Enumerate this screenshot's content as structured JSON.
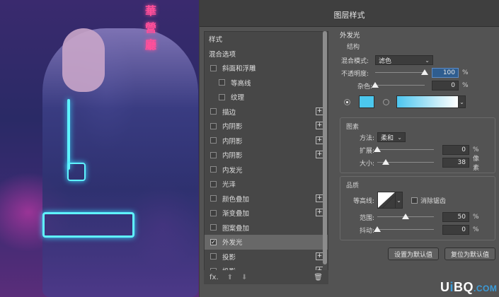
{
  "dialog": {
    "title": "图层样式"
  },
  "styles_list": {
    "header": "样式",
    "blend_options": "混合选项",
    "items": [
      {
        "label": "斜面和浮雕",
        "checked": false,
        "indent": false,
        "plus": false
      },
      {
        "label": "等高线",
        "checked": false,
        "indent": true,
        "plus": false
      },
      {
        "label": "纹理",
        "checked": false,
        "indent": true,
        "plus": false
      },
      {
        "label": "描边",
        "checked": false,
        "indent": false,
        "plus": true
      },
      {
        "label": "内阴影",
        "checked": false,
        "indent": false,
        "plus": true
      },
      {
        "label": "内阴影",
        "checked": false,
        "indent": false,
        "plus": true
      },
      {
        "label": "内阴影",
        "checked": false,
        "indent": false,
        "plus": true
      },
      {
        "label": "内发光",
        "checked": false,
        "indent": false,
        "plus": false
      },
      {
        "label": "光泽",
        "checked": false,
        "indent": false,
        "plus": false
      },
      {
        "label": "颜色叠加",
        "checked": false,
        "indent": false,
        "plus": true
      },
      {
        "label": "渐变叠加",
        "checked": false,
        "indent": false,
        "plus": true
      },
      {
        "label": "图案叠加",
        "checked": false,
        "indent": false,
        "plus": false
      },
      {
        "label": "外发光",
        "checked": true,
        "indent": false,
        "plus": false,
        "active": true
      },
      {
        "label": "投影",
        "checked": false,
        "indent": false,
        "plus": true
      },
      {
        "label": "投影",
        "checked": false,
        "indent": false,
        "plus": true
      }
    ],
    "fx_label": "fx.",
    "up_arrow": "⬆",
    "down_arrow": "⬇",
    "trash_icon": "🗑"
  },
  "outer_glow": {
    "title": "外发光",
    "structure": {
      "title": "结构",
      "blend_mode_label": "混合模式:",
      "blend_mode_value": "滤色",
      "opacity_label": "不透明度:",
      "opacity_value": "100",
      "opacity_unit": "%",
      "opacity_level": 1.0,
      "noise_label": "杂色:",
      "noise_value": "0",
      "noise_unit": "%",
      "noise_level": 0.0,
      "color_swatch": "#4cc8ee"
    },
    "elements": {
      "title": "图素",
      "method_label": "方法:",
      "method_value": "柔和",
      "spread_label": "扩展:",
      "spread_value": "0",
      "spread_unit": "%",
      "spread_level": 0.0,
      "size_label": "大小:",
      "size_value": "38",
      "size_unit": "像素",
      "size_level": 0.15
    },
    "quality": {
      "title": "品质",
      "contour_label": "等高线:",
      "antialias_label": "消除锯齿",
      "range_label": "范围:",
      "range_value": "50",
      "range_unit": "%",
      "range_level": 0.5,
      "jitter_label": "抖动:",
      "jitter_value": "0",
      "jitter_unit": "%",
      "jitter_level": 0.0
    },
    "buttons": {
      "set_default": "设置为默认值",
      "reset_default": "复位为默认值"
    }
  },
  "background": {
    "signs": [
      "華",
      "營",
      "廳"
    ]
  },
  "watermark": {
    "u": "U",
    "i": "i",
    "b": "B",
    "q": "Q",
    "dot": ".",
    "com": "COM"
  }
}
